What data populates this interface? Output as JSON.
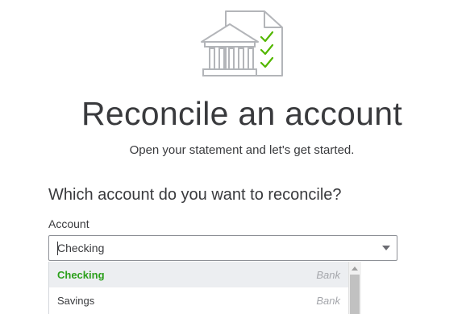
{
  "header": {
    "illustration_icon": "bank-reconcile-checklist-icon",
    "title": "Reconcile an account",
    "subtitle": "Open your statement and let's get started."
  },
  "form": {
    "question": "Which account do you want to reconcile?",
    "account_label": "Account",
    "account_value": "Checking"
  },
  "dropdown": {
    "options": [
      {
        "name": "Checking",
        "type": "Bank",
        "selected": true
      },
      {
        "name": "Savings",
        "type": "Bank",
        "selected": false
      }
    ]
  },
  "colors": {
    "selected_text": "#2ca01c",
    "checkmark": "#53b700",
    "text": "#393a3d"
  }
}
